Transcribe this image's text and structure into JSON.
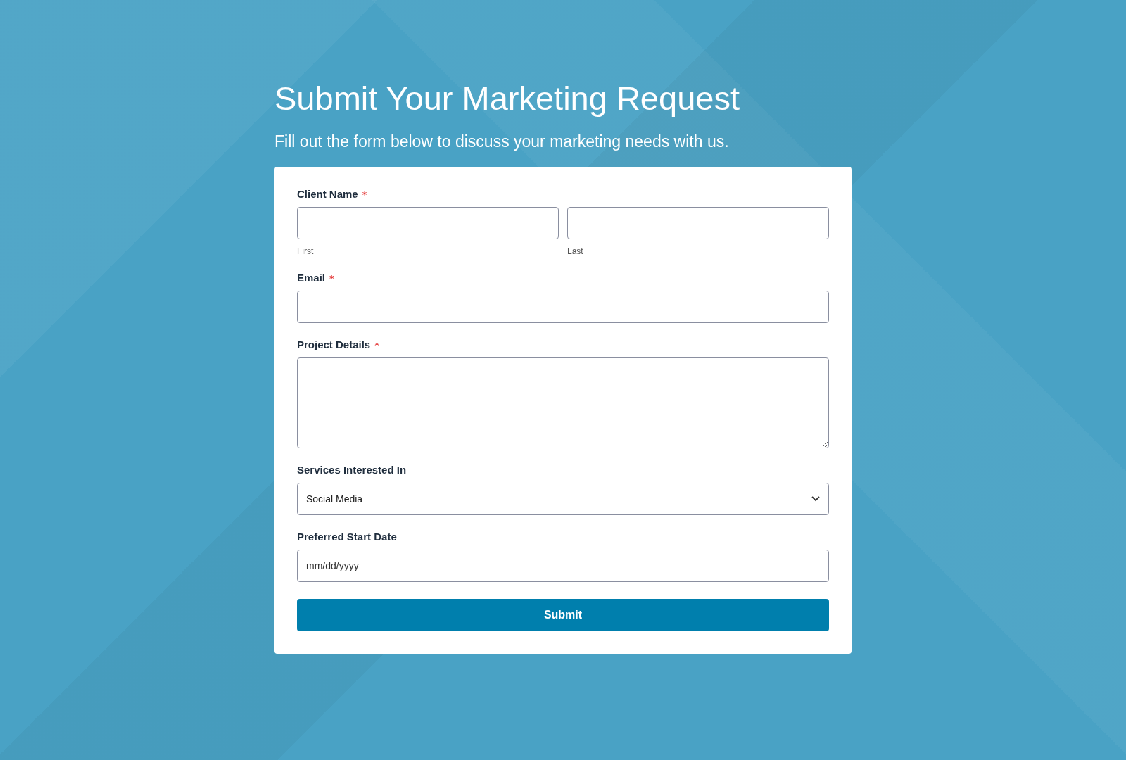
{
  "header": {
    "title": "Submit Your Marketing Request",
    "subtitle": "Fill out the form below to discuss your marketing needs with us."
  },
  "form": {
    "fields": [
      {
        "kind": "name",
        "label": "Client Name",
        "required_mark": "*",
        "sublabels": [
          "First",
          "Last"
        ]
      },
      {
        "kind": "text",
        "label": "Email",
        "required_mark": "*"
      },
      {
        "kind": "textarea",
        "label": "Project Details",
        "required_mark": "*"
      },
      {
        "kind": "select",
        "label": "Services Interested In",
        "value": "Social Media"
      },
      {
        "kind": "date",
        "label": "Preferred Start Date",
        "placeholder": "mm/dd/yyyy"
      }
    ],
    "submit": "Submit"
  }
}
